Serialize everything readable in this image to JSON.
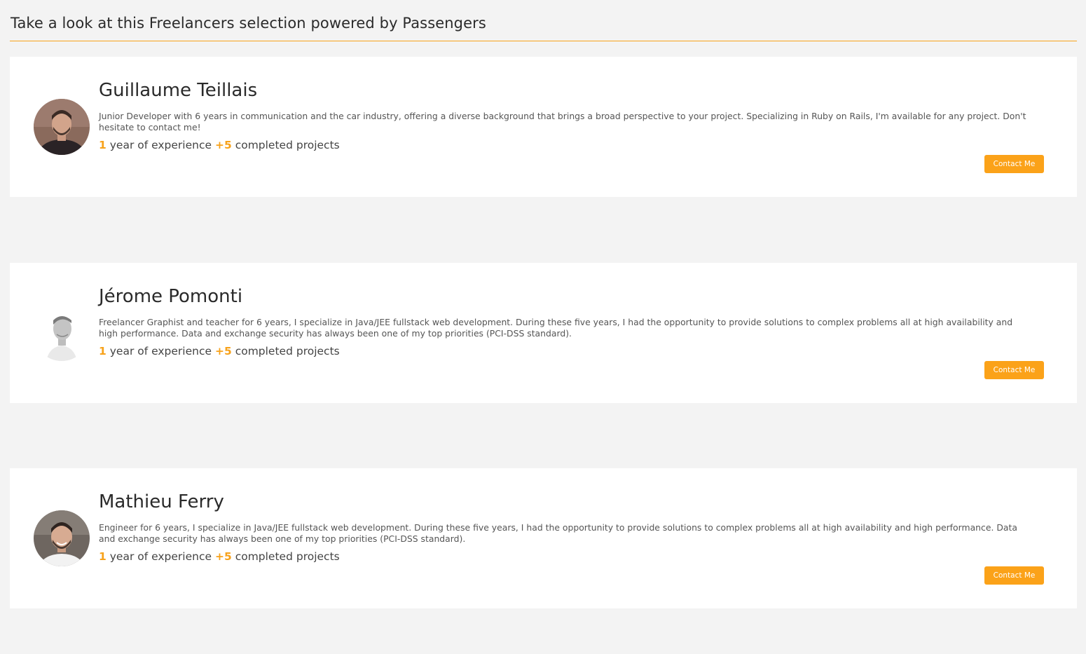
{
  "page": {
    "title": "Take a look at this Freelancers selection powered by Passengers"
  },
  "theme": {
    "accent": "#f7a21b",
    "button_color": "#fba219",
    "background": "#f3f3f3",
    "card_background": "#ffffff"
  },
  "freelancers": [
    {
      "name": "Guillaume Teillais",
      "bio": "Junior Developer with 6 years in communication and the car industry, offering a diverse background that brings a broad perspective to your project. Specializing in Ruby on Rails, I'm available for any project. Don't hesitate to contact me!",
      "experience_value": "1",
      "experience_text": "year of experience",
      "projects_value": "+5",
      "projects_text": "completed projects",
      "contact_label": "Contact Me"
    },
    {
      "name": "Jérome Pomonti",
      "bio": "Freelancer Graphist and teacher for 6 years, I specialize in Java/JEE fullstack web development. During these five years, I had the opportunity to provide solutions to complex problems all at high availability and high performance. Data and exchange security has always been one of my top priorities (PCI-DSS standard).",
      "experience_value": "1",
      "experience_text": "year of experience",
      "projects_value": "+5",
      "projects_text": "completed projects",
      "contact_label": "Contact Me"
    },
    {
      "name": "Mathieu Ferry",
      "bio": "Engineer for 6 years, I specialize in Java/JEE fullstack web development. During these five years, I had the opportunity to provide solutions to complex problems all at high availability and high performance. Data and exchange security has always been one of my top priorities (PCI-DSS standard).",
      "experience_value": "1",
      "experience_text": "year of experience",
      "projects_value": "+5",
      "projects_text": "completed projects",
      "contact_label": "Contact Me"
    }
  ]
}
